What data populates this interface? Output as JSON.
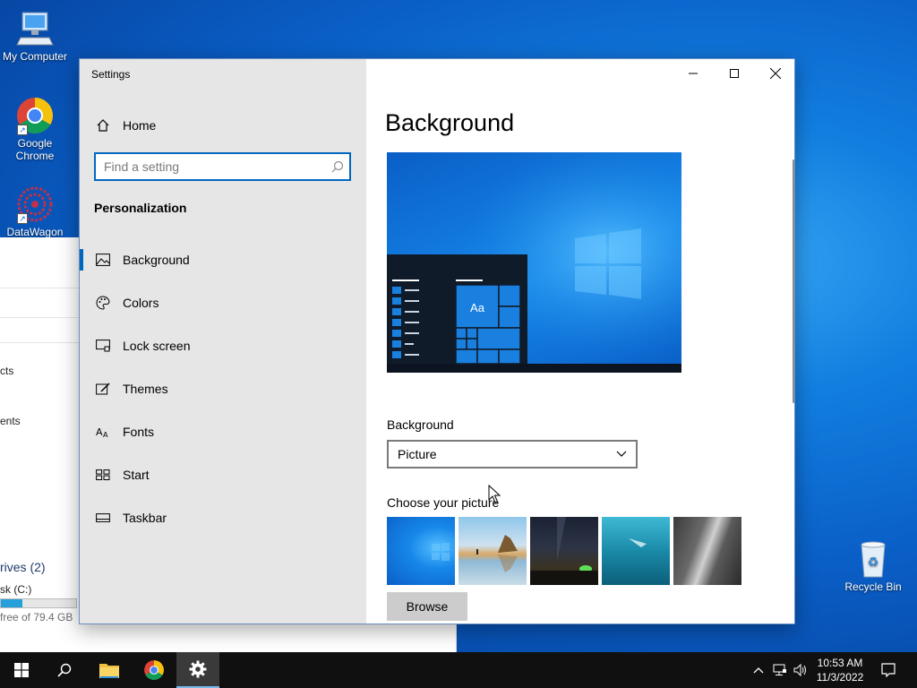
{
  "desktop": {
    "icons": [
      {
        "label": "My Computer"
      },
      {
        "label": "Google Chrome"
      },
      {
        "label": "DataWagon"
      },
      {
        "label": "Recycle Bin"
      }
    ]
  },
  "explorer": {
    "partial_texts": [
      "cts",
      "ents",
      "rives (2)",
      "sk (C:)",
      "free of 79.4 GB"
    ],
    "disk_used_fraction": 0.28
  },
  "settings": {
    "window_title": "Settings",
    "home_label": "Home",
    "search_placeholder": "Find a setting",
    "section_title": "Personalization",
    "nav_items": [
      {
        "label": "Background",
        "icon": "picture-icon",
        "active": true
      },
      {
        "label": "Colors",
        "icon": "palette-icon",
        "active": false
      },
      {
        "label": "Lock screen",
        "icon": "lock-screen-icon",
        "active": false
      },
      {
        "label": "Themes",
        "icon": "themes-icon",
        "active": false
      },
      {
        "label": "Fonts",
        "icon": "fonts-icon",
        "active": false
      },
      {
        "label": "Start",
        "icon": "start-icon",
        "active": false
      },
      {
        "label": "Taskbar",
        "icon": "taskbar-icon",
        "active": false
      }
    ],
    "page_title": "Background",
    "preview_tile_text": "Aa",
    "background_label": "Background",
    "background_value": "Picture",
    "choose_label": "Choose your picture",
    "browse_label": "Browse",
    "accent_color": "#0067c0"
  },
  "taskbar": {
    "time": "10:53 AM",
    "date": "11/3/2022"
  }
}
